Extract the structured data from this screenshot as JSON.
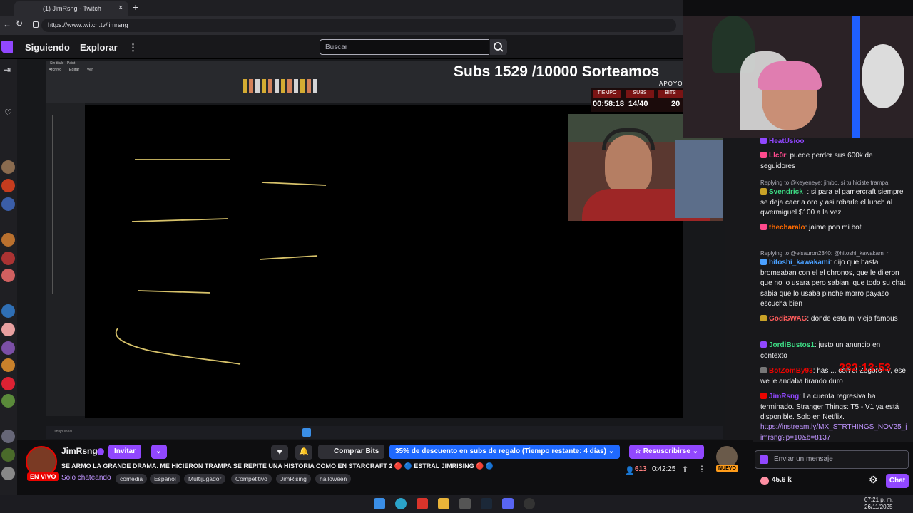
{
  "browser": {
    "tab_title": "(1) JimRsng - Twitch",
    "url": "https://www.twitch.tv/jimrsng"
  },
  "nav": {
    "following": "Siguiendo",
    "browse": "Explorar",
    "more": "⋮",
    "search_placeholder": "Buscar"
  },
  "overlay": {
    "title": "Subs 1529 /10000 Sorteamos",
    "supports_label": "APOYOS",
    "time_label": "TIEMPO",
    "time_value": "00:58:18",
    "subs_label": "SUBS",
    "subs_value": "14/40",
    "bits_label": "BITS",
    "bits_value": "20"
  },
  "paint": {
    "window_title": "Sin título - Paint",
    "menu": [
      "Archivo",
      "Editar",
      "Ver"
    ],
    "status": "Dibujo lineal"
  },
  "channel": {
    "name": "JimRsng",
    "live_label": "EN VIVO",
    "invite_label": "Invitar",
    "buy_bits_label": "Comprar Bits",
    "promo_label": "35% de descuento en subs de regalo (Tiempo restante: 4 días)",
    "resubscribe_label": "Resuscribirse",
    "new_label": "NUEVO",
    "stream_title": "SE ARMO LA GRANDE DRAMA. ME HICIERON TRAMPA SE REPITE UNA HISTORIA COMO EN STARCRAFT 2 🔴 🔵 ESTRAL JIMRISING 🔴 🔵",
    "category": "Solo chateando",
    "tags": [
      "comedia",
      "Español",
      "Multijugador",
      "Competitivo",
      "JimRising",
      "halloween"
    ],
    "viewers": "613",
    "uptime": "0:42:25"
  },
  "chat": {
    "messages": [
      {
        "user": "HeatUsioo",
        "color": "#9147ff",
        "text": ""
      },
      {
        "user": "Llc0r",
        "color": "#ff4a8d",
        "text": "puede perder sus 600k de seguidores"
      },
      {
        "reply": "Replying to @keyeneye: jimbo, si tu hiciste trampa"
      },
      {
        "user": "Svendrick_",
        "color": "#3ddc84",
        "text": "si para el gamercraft siempre se deja caer a oro y asi robarle el lunch al qwermiguel $100 a la vez"
      },
      {
        "user": "thecharalo",
        "color": "#ff6a00",
        "text": "jaime pon mi bot"
      },
      {
        "reply": "Replying to @elsauron2340: @hitoshi_kawakami r"
      },
      {
        "user": "hitoshi_kawakami",
        "color": "#4aa0ff",
        "text": "dijo que hasta bromeaban con el el chronos, que le dijeron que no lo usara pero sabian, que todo su chat sabia que lo usaba pinche morro payaso escucha bien"
      },
      {
        "user": "GodiSWAG",
        "color": "#ff5c5c",
        "text": "donde esta mi vieja famous"
      },
      {
        "user": "JordiBustos1",
        "color": "#3ddc84",
        "text": "justo un anuncio en contexto"
      },
      {
        "user": "BotZomBy93",
        "color": "#eb0400",
        "text": "has ... con el ZogoroTV, ese we le andaba tirando duro"
      },
      {
        "user": "JimRsng",
        "color": "#9147ff",
        "text": "La cuenta regresiva ha terminado. Stranger Things: T5 - V1 ya está disponible. Solo en Netflix."
      },
      {
        "link": "https://instream.ly/MX_STRTHINGS_NOV25_jimrsng?p=10&b=8137"
      }
    ],
    "countdown": "282:13:53",
    "input_placeholder": "Enviar un mensaje",
    "points": "45.6 k",
    "chat_button": "Chat"
  },
  "system": {
    "time": "07:21 p. m.",
    "date": "26/11/2025"
  },
  "colors": {
    "twitch_purple": "#9147ff",
    "live_red": "#eb0400",
    "promo_blue": "#1f69ff"
  }
}
